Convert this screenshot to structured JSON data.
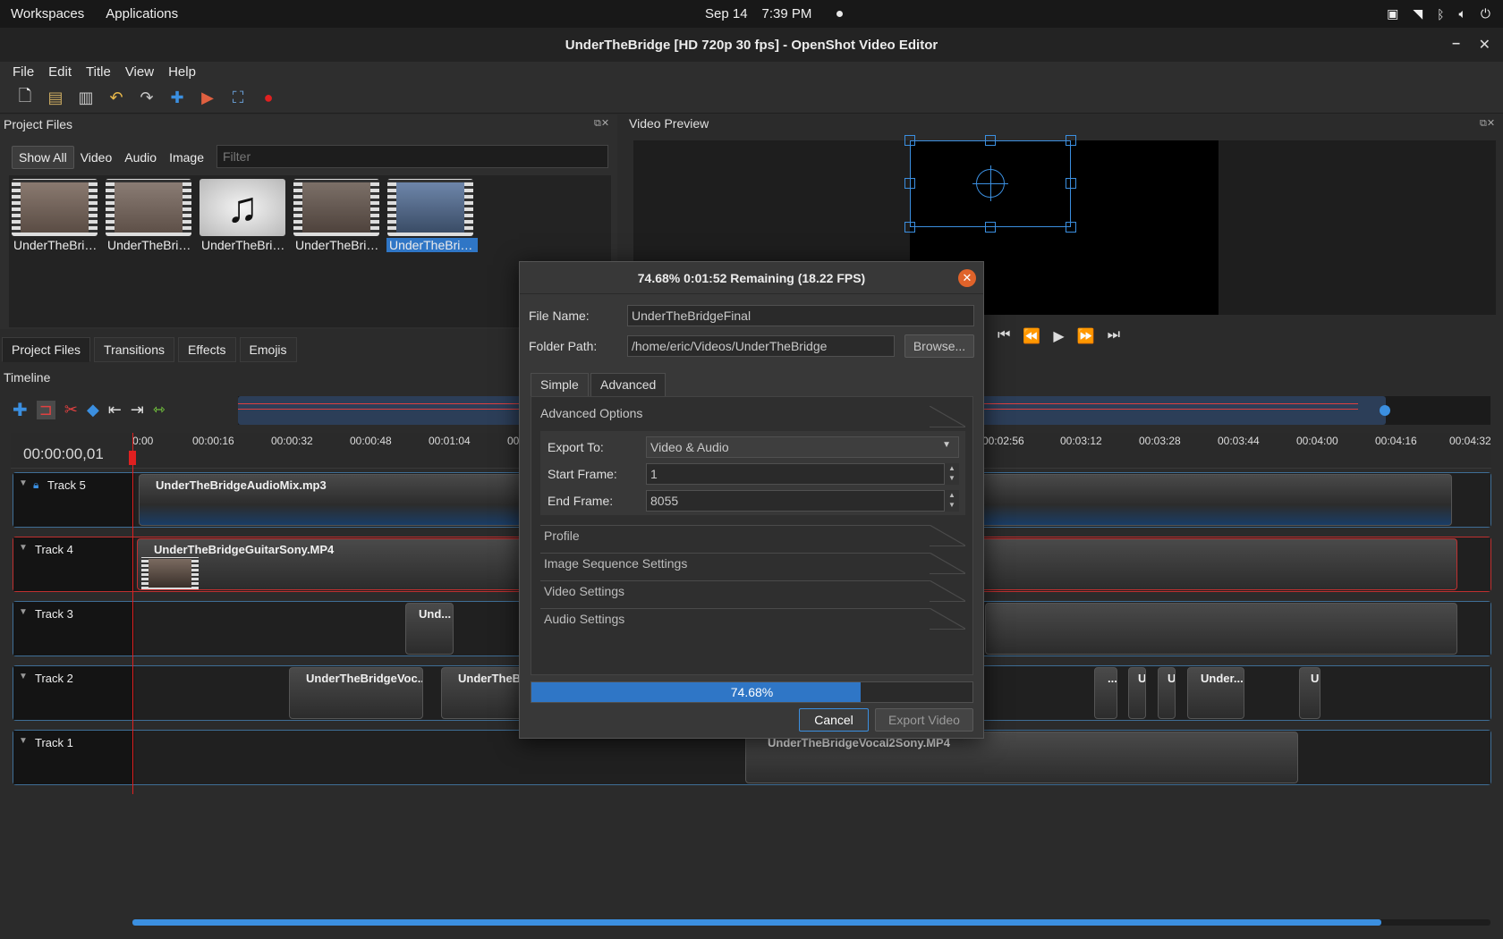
{
  "system": {
    "workspaces": "Workspaces",
    "applications": "Applications",
    "date": "Sep 14",
    "time": "7:39 PM"
  },
  "window": {
    "title": "UnderTheBridge [HD 720p 30 fps] - OpenShot Video Editor"
  },
  "menu": {
    "file": "File",
    "edit": "Edit",
    "title": "Title",
    "view": "View",
    "help": "Help"
  },
  "project_files": {
    "title": "Project Files",
    "filters": [
      "Show All",
      "Video",
      "Audio",
      "Image"
    ],
    "filter_placeholder": "Filter",
    "items": [
      "UnderTheBri…",
      "UnderTheBri…",
      "UnderTheBri…",
      "UnderTheBri…",
      "UnderTheBri…"
    ]
  },
  "video_preview": {
    "title": "Video Preview"
  },
  "bottom_tabs": [
    "Project Files",
    "Transitions",
    "Effects",
    "Emojis"
  ],
  "timeline": {
    "title": "Timeline",
    "current_time": "00:00:00,01",
    "ticks": [
      "0:00",
      "00:00:16",
      "00:00:32",
      "00:00:48",
      "00:01:04",
      "00",
      "00:02:56",
      "00:03:12",
      "00:03:28",
      "00:03:44",
      "00:04:00",
      "00:04:16",
      "00:04:32"
    ],
    "tracks": [
      {
        "name": "Track 5",
        "clips": [
          "UnderTheBridgeAudioMix.mp3"
        ]
      },
      {
        "name": "Track 4",
        "clips": [
          "UnderTheBridgeGuitarSony.MP4"
        ]
      },
      {
        "name": "Track 3",
        "clips": [
          "Und..."
        ]
      },
      {
        "name": "Track 2",
        "clips": [
          "UnderTheBridgeVoc...",
          "UnderTheB",
          "...",
          "U",
          "U",
          "Under...",
          "U"
        ]
      },
      {
        "name": "Track 1",
        "clips": [
          "UnderTheBridgeVocal2Sony.MP4"
        ]
      }
    ]
  },
  "export_dialog": {
    "title": "74.68%  0:01:52 Remaining (18.22 FPS)",
    "file_name_label": "File Name:",
    "file_name": "UnderTheBridgeFinal",
    "folder_path_label": "Folder Path:",
    "folder_path": "/home/eric/Videos/UnderTheBridge",
    "browse": "Browse...",
    "tabs": [
      "Simple",
      "Advanced"
    ],
    "advanced_options": "Advanced Options",
    "export_to_label": "Export To:",
    "export_to": "Video & Audio",
    "start_frame_label": "Start Frame:",
    "start_frame": "1",
    "end_frame_label": "End Frame:",
    "end_frame": "8055",
    "sections": [
      "Profile",
      "Image Sequence Settings",
      "Video Settings",
      "Audio Settings"
    ],
    "progress": 74.68,
    "progress_text": "74.68%",
    "cancel": "Cancel",
    "export_video": "Export Video"
  }
}
